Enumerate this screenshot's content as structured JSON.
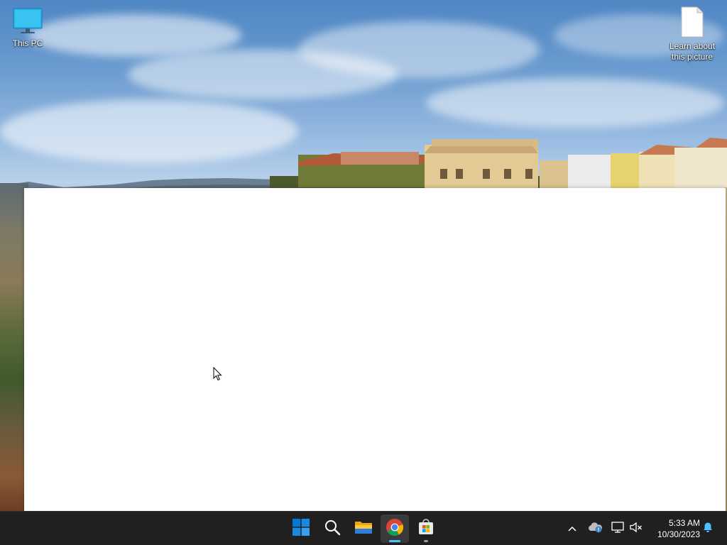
{
  "desktop": {
    "icons": [
      {
        "label": "This PC",
        "icon": "monitor-icon"
      },
      {
        "label": "Learn about this picture",
        "icon": "document-icon"
      }
    ]
  },
  "window": {
    "state": "blank white window, no content"
  },
  "taskbar": {
    "apps": [
      {
        "name": "Start",
        "icon": "windows-start-icon"
      },
      {
        "name": "Search",
        "icon": "search-icon"
      },
      {
        "name": "File Explorer",
        "icon": "folder-icon"
      },
      {
        "name": "Google Chrome",
        "icon": "chrome-icon",
        "active": true
      },
      {
        "name": "Microsoft Store",
        "icon": "store-icon",
        "running": true
      }
    ],
    "tray": {
      "icons": [
        "chevron-up-icon",
        "onedrive-icon",
        "network-icon",
        "volume-muted-icon",
        "notification-bell-icon"
      ]
    },
    "clock": {
      "time": "5:33 AM",
      "date": "10/30/2023"
    }
  },
  "colors": {
    "taskbar_bg": "#202020",
    "windows_blue": "#0078d4",
    "active_indicator": "#4cc2ff",
    "window_bg": "#ffffff"
  }
}
